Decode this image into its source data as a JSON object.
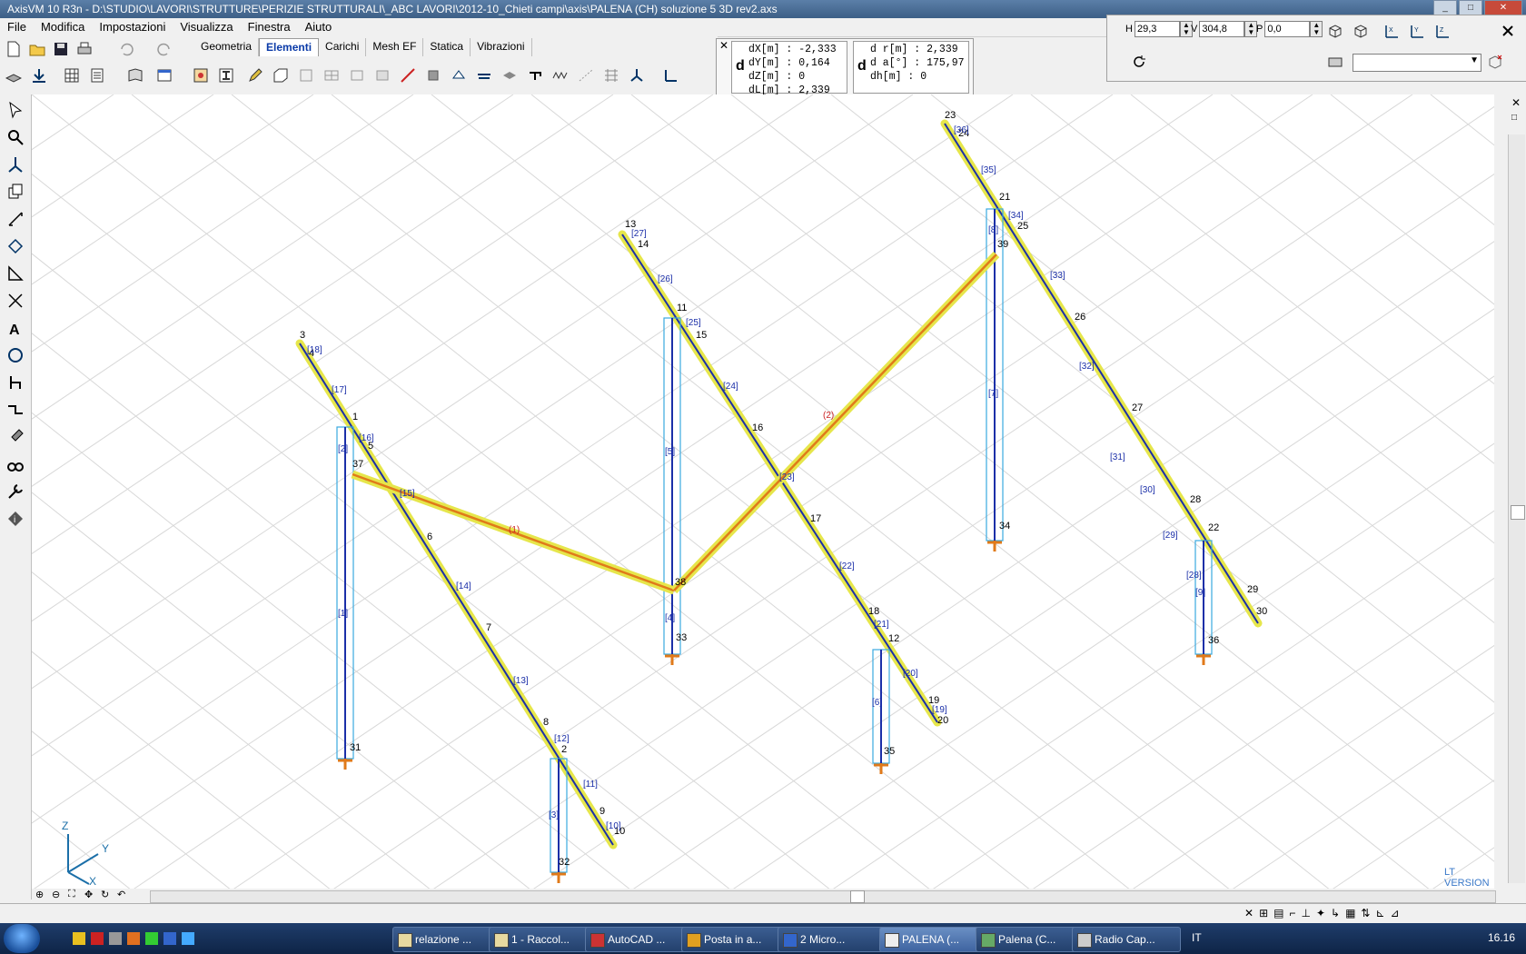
{
  "window": {
    "title": "AxisVM 10 R3n - D:\\STUDIO\\LAVORI\\STRUTTURE\\PERIZIE STRUTTURALI\\_ABC LAVORI\\2012-10_Chieti campi\\axis\\PALENA (CH) soluzione 5 3D rev2.axs",
    "buttons": [
      "_",
      "□",
      "✕"
    ]
  },
  "menu": [
    "File",
    "Modifica",
    "Impostazioni",
    "Visualizza",
    "Finestra",
    "Aiuto"
  ],
  "tabs": [
    {
      "label": "Geometria",
      "active": false
    },
    {
      "label": "Elementi",
      "active": true
    },
    {
      "label": "Carichi",
      "active": false
    },
    {
      "label": "Mesh EF",
      "active": false
    },
    {
      "label": "Statica",
      "active": false
    },
    {
      "label": "Vibrazioni",
      "active": false
    }
  ],
  "coords": {
    "left": {
      "d": "d",
      "rows": "dX[m] : -2,333\ndY[m] : 0,164\ndZ[m] : 0\ndL[m] : 2,339"
    },
    "right": {
      "d": "d",
      "rows": "d r[m] : 2,339\nd a[°] : 175,97\ndh[m] : 0"
    }
  },
  "view": {
    "h_label": "H",
    "h_value": "29,3",
    "v_label": "V",
    "v_value": "304,8",
    "p_label": "P",
    "p_value": "0,0",
    "dropdown_value": ""
  },
  "model": {
    "node_labels": [
      "1",
      "2",
      "3",
      "4",
      "5",
      "6",
      "7",
      "8",
      "9",
      "10",
      "11",
      "12",
      "13",
      "14",
      "15",
      "16",
      "17",
      "18",
      "19",
      "20",
      "21",
      "22",
      "23",
      "24",
      "25",
      "26",
      "27",
      "28",
      "29",
      "30",
      "31",
      "32",
      "33",
      "34",
      "35",
      "36",
      "37",
      "38",
      "39"
    ],
    "beam_labels": [
      "1",
      "2",
      "3",
      "4",
      "5",
      "6",
      "7",
      "8",
      "9",
      "10",
      "11",
      "12",
      "13",
      "14",
      "15",
      "16",
      "17",
      "18",
      "19",
      "20",
      "21",
      "22",
      "23",
      "24",
      "25",
      "26",
      "27",
      "28",
      "29",
      "30",
      "31",
      "32",
      "33",
      "34",
      "35",
      "36"
    ],
    "brace_labels": [
      "1",
      "2"
    ],
    "axis_labels": {
      "z": "Z",
      "y": "Y",
      "x": "X"
    }
  },
  "ltversion": "LT VERSION",
  "taskbar": {
    "items": [
      {
        "label": "relazione ...",
        "active": false
      },
      {
        "label": "1 - Raccol...",
        "active": false
      },
      {
        "label": "AutoCAD ...",
        "active": false
      },
      {
        "label": "Posta in a...",
        "active": false
      },
      {
        "label": "2 Micro...",
        "active": false
      },
      {
        "label": "PALENA (...",
        "active": true
      },
      {
        "label": "Palena (C...",
        "active": false
      },
      {
        "label": "Radio Cap...",
        "active": false
      }
    ],
    "language": "IT",
    "clock": "16.16"
  },
  "colors": {
    "beam_yellow": "#e6e64b",
    "beam_blue": "#1b2fa8",
    "column_cyan": "#3aa9e0",
    "brace_orange": "#e07a1a",
    "grid": "#d8d8d8"
  }
}
